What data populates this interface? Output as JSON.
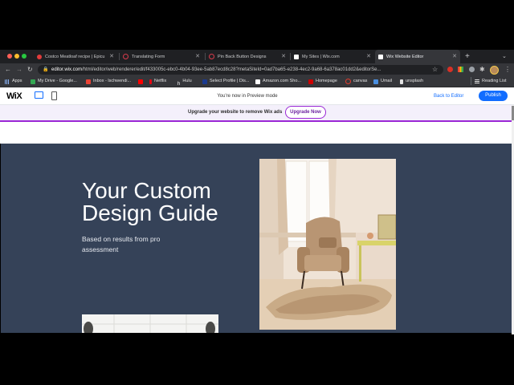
{
  "browser": {
    "tabs": [
      {
        "title": "Costco Meatloaf recipe | Epicu",
        "fav_color": "#e23b3b"
      },
      {
        "title": "Translating Form",
        "fav_color": "#d93b4b"
      },
      {
        "title": "Pin Back Button Designs",
        "fav_color": "#d93b4b"
      },
      {
        "title": "My Sites | Wix.com",
        "fav_color": "#ffffff"
      },
      {
        "title": "Wix Website Editor",
        "fav_color": "#ffffff"
      }
    ],
    "new_tab": "+",
    "close_glyph": "✕",
    "url_host": "editor.wix.com",
    "url_path": "/html/editor/web/renderer/edit/f433005c-ebc0-4b04-93ee-5ab87ecd8c28?metaSiteId=0ad7ba65-e238-4ec2-9a68-6a378ac01dd2&editorSe...",
    "bookmarks": [
      {
        "label": "Apps",
        "color": "#8ab4f8"
      },
      {
        "label": "My Drive - Google...",
        "color": "#34a853"
      },
      {
        "label": "Inbox - lschwendi...",
        "color": "#ea4335"
      },
      {
        "label": "",
        "color": "#ff0000"
      },
      {
        "label": "Netflix",
        "color": "#e50914"
      },
      {
        "label": "Hulu",
        "color": "#1ce783"
      },
      {
        "label": "Select Profile | Dis...",
        "color": "#1a3a8f"
      },
      {
        "label": "Amazon.com Sho...",
        "color": "#ffffff"
      },
      {
        "label": "Homepage",
        "color": "#cc0000"
      },
      {
        "label": "canvas",
        "color": "#e13c2c"
      },
      {
        "label": "Umail",
        "color": "#4a8fe0"
      },
      {
        "label": "unsplash",
        "color": "#222222"
      }
    ],
    "reading_list": "Reading List"
  },
  "wix": {
    "logo": "WiX",
    "preview_message": "You're now in Preview mode",
    "back_to_editor": "Back to Editor",
    "publish": "Publish",
    "upgrade_text": "Upgrade your website to remove Wix ads",
    "upgrade_button": "Upgrade Now",
    "accent": "#116dff",
    "upgrade_accent": "#9a27d5"
  },
  "site": {
    "hero_title": "Your Custom Design Guide",
    "hero_subtitle": "Based on results from pro assessment",
    "hero_bg": "#354258"
  }
}
